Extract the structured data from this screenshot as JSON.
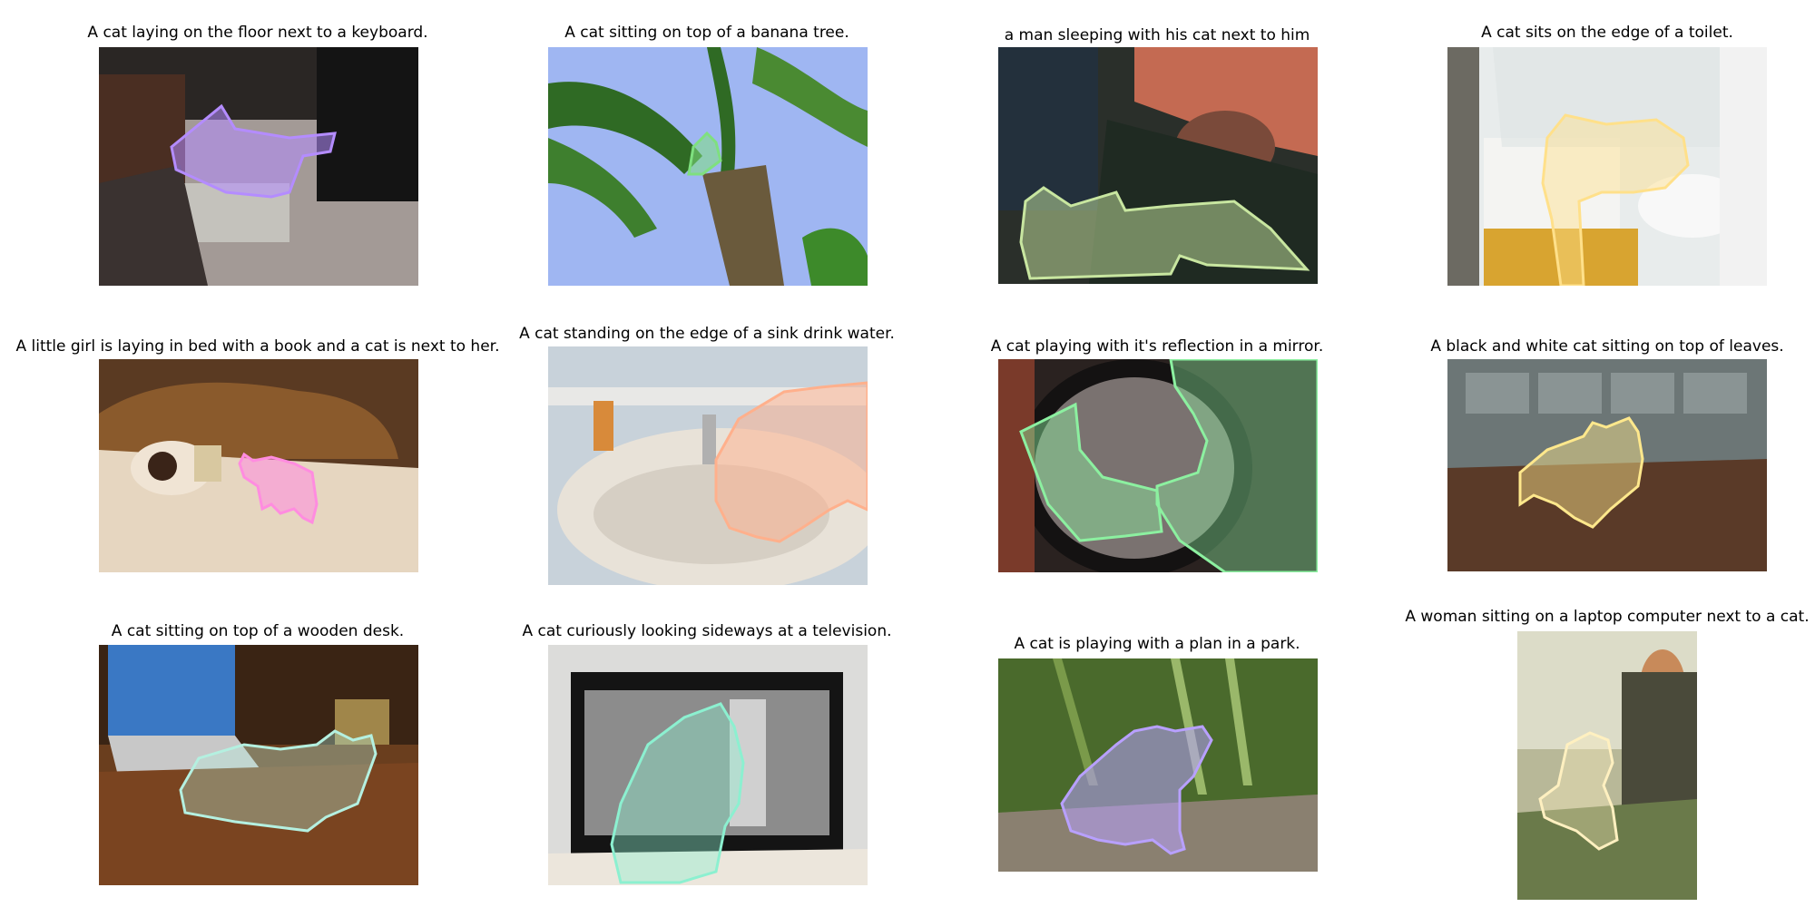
{
  "panels": [
    {
      "caption": "A cat laying on the floor next to a keyboard.",
      "mask_color": "#b48cff"
    },
    {
      "caption": "A cat sitting on top of a banana tree.",
      "mask_color": "#7fe07f"
    },
    {
      "caption": "a man sleeping with his cat next to him",
      "mask_color": "#c8e6a0"
    },
    {
      "caption": "A cat sits on the edge of a toilet.",
      "mask_color": "#ffe08a"
    },
    {
      "caption": "A little girl is laying in bed with a book and a cat is next to her.",
      "mask_color": "#ff8ce0"
    },
    {
      "caption": "A cat standing on the edge of a sink drink water.",
      "mask_color": "#ffb08c"
    },
    {
      "caption": "A cat playing with it's reflection in a mirror.",
      "mask_color": "#8cf0a0"
    },
    {
      "caption": "A black and white cat sitting on top of leaves.",
      "mask_color": "#ffe88c"
    },
    {
      "caption": "A cat sitting on top of a wooden desk.",
      "mask_color": "#b4f0e0"
    },
    {
      "caption": "A cat curiously looking sideways at a television.",
      "mask_color": "#8cf0d0"
    },
    {
      "caption": "A cat is playing with a plan in a park.",
      "mask_color": "#b8a0ff"
    },
    {
      "caption": "A woman sitting on a laptop computer next to a cat.",
      "mask_color": "#fff0c0"
    }
  ]
}
